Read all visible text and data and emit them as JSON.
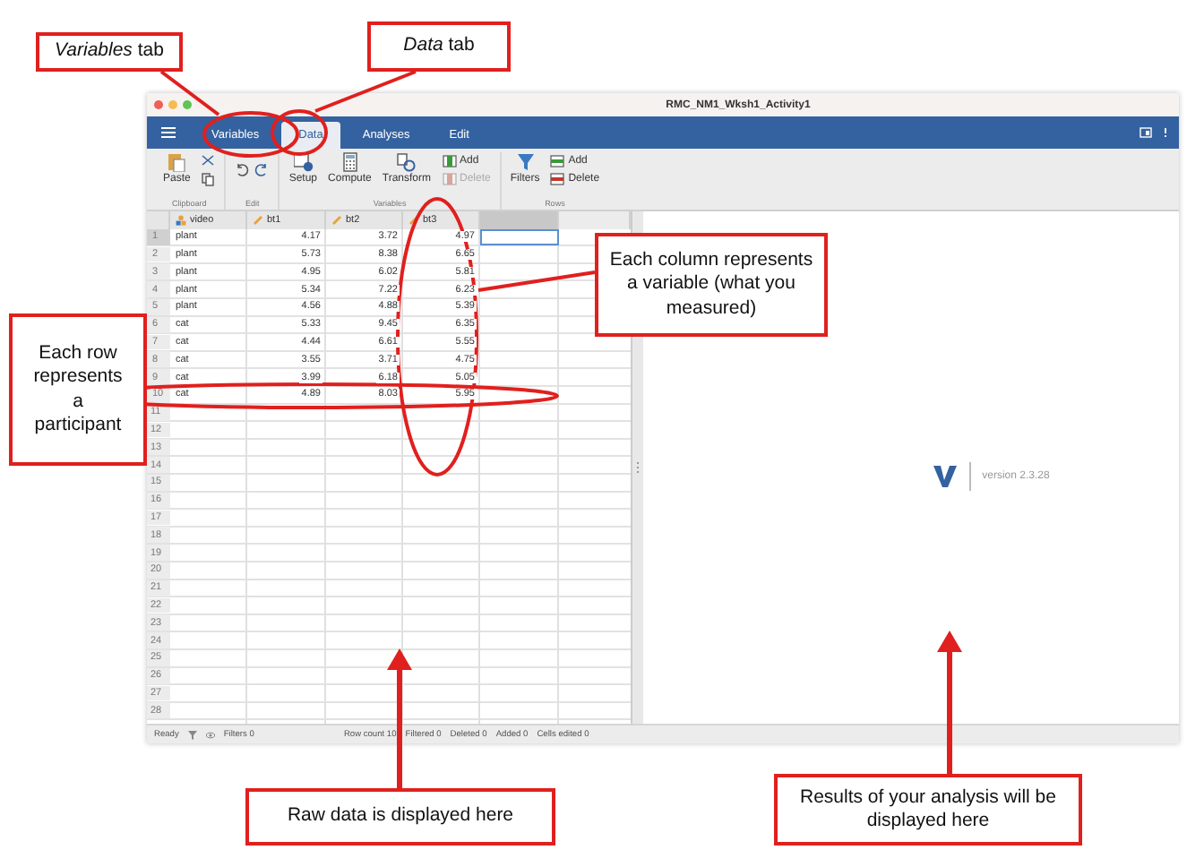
{
  "window": {
    "title": "RMC_NM1_Wksh1_Activity1"
  },
  "tabs": [
    {
      "label": "Variables",
      "selected": false
    },
    {
      "label": "Data",
      "selected": true
    },
    {
      "label": "Analyses",
      "selected": false
    },
    {
      "label": "Edit",
      "selected": false
    }
  ],
  "toolbar": {
    "groups": [
      {
        "label": "Clipboard",
        "items": [
          {
            "kind": "paste",
            "label": "Paste"
          },
          {
            "kind": "cutcopy"
          }
        ]
      },
      {
        "label": "Edit",
        "items": [
          {
            "kind": "undoredo"
          }
        ]
      },
      {
        "label": "Variables",
        "items": [
          {
            "kind": "setup",
            "label": "Setup"
          },
          {
            "kind": "compute",
            "label": "Compute"
          },
          {
            "kind": "transform",
            "label": "Transform"
          },
          {
            "kind": "adddelete",
            "add": "Add",
            "delete": "Delete",
            "disabled_delete": true
          }
        ]
      },
      {
        "label": "Rows",
        "items": [
          {
            "kind": "filters",
            "label": "Filters"
          },
          {
            "kind": "adddelete",
            "add": "Add",
            "delete": "Delete",
            "disabled_delete": false
          }
        ]
      }
    ]
  },
  "table": {
    "columns": [
      {
        "name": "video",
        "kind": "nominal"
      },
      {
        "name": "bt1",
        "kind": "continuous"
      },
      {
        "name": "bt2",
        "kind": "continuous"
      },
      {
        "name": "bt3",
        "kind": "continuous"
      }
    ],
    "rows": [
      {
        "number": "1",
        "cells": [
          "plant",
          "4.17",
          "3.72",
          "4.97"
        ]
      },
      {
        "number": "2",
        "cells": [
          "plant",
          "5.73",
          "8.38",
          "6.65"
        ]
      },
      {
        "number": "3",
        "cells": [
          "plant",
          "4.95",
          "6.02",
          "5.81"
        ]
      },
      {
        "number": "4",
        "cells": [
          "plant",
          "5.34",
          "7.22",
          "6.23"
        ]
      },
      {
        "number": "5",
        "cells": [
          "plant",
          "4.56",
          "4.88",
          "5.39"
        ]
      },
      {
        "number": "6",
        "cells": [
          "cat",
          "5.33",
          "9.45",
          "6.35"
        ]
      },
      {
        "number": "7",
        "cells": [
          "cat",
          "4.44",
          "6.61",
          "5.55"
        ]
      },
      {
        "number": "8",
        "cells": [
          "cat",
          "3.55",
          "3.71",
          "4.75"
        ]
      },
      {
        "number": "9",
        "cells": [
          "cat",
          "3.99",
          "6.18",
          "5.05"
        ]
      },
      {
        "number": "10",
        "cells": [
          "cat",
          "4.89",
          "8.03",
          "5.95"
        ]
      }
    ],
    "empty_rows": [
      "11",
      "12",
      "13",
      "14",
      "15",
      "16",
      "17",
      "18",
      "19",
      "20",
      "21",
      "22",
      "23",
      "24",
      "25",
      "26",
      "27",
      "28"
    ]
  },
  "status_bar": {
    "ready": "Ready",
    "items": [
      "Filters 0",
      "Row count 10",
      "Filtered 0",
      "Deleted 0",
      "Added 0",
      "Cells edited 0"
    ]
  },
  "results": {
    "version": "version 2.3.28"
  },
  "annotations": [
    {
      "text": "*Variables* tab"
    },
    {
      "text": "*Data* tab"
    },
    {
      "text": "Each column represents a variable (what you measured)"
    },
    {
      "text": "Each row represents a participant"
    },
    {
      "text": "Raw data is displayed here"
    },
    {
      "text": "Results of your analysis will be displayed here"
    }
  ]
}
